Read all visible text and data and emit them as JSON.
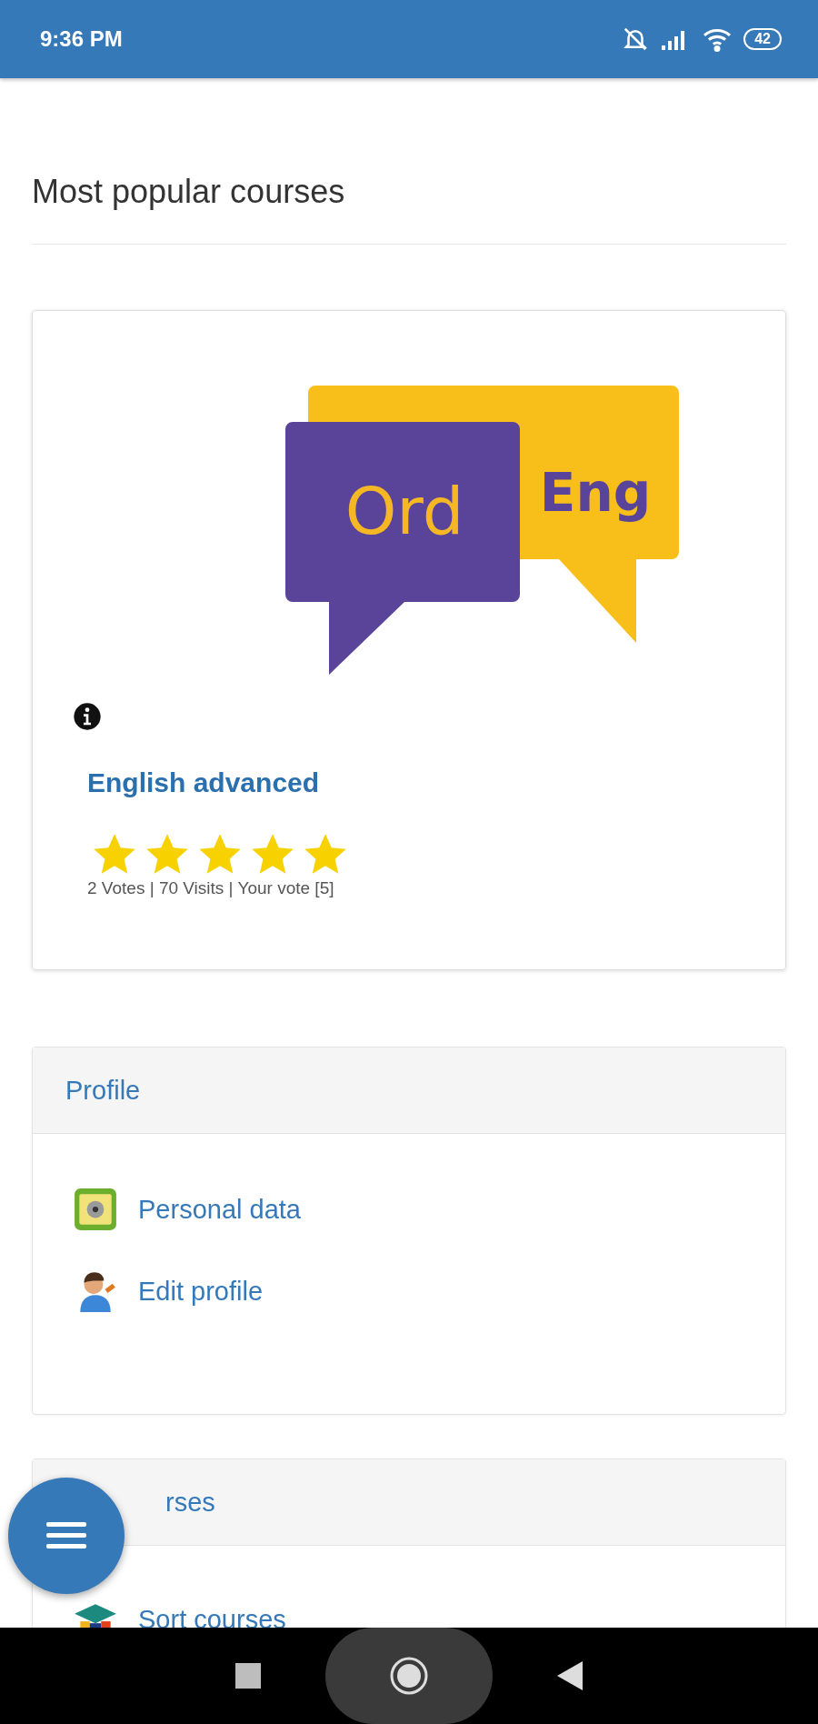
{
  "status_bar": {
    "time": "9:36 PM",
    "battery": "42"
  },
  "section_title": "Most popular courses",
  "course_card": {
    "logo": {
      "left_text": "Ord",
      "right_text": "Eng"
    },
    "title": "English advanced",
    "stars": 5,
    "stats": "2 Votes | 70 Visits | Your vote [5]"
  },
  "panels": [
    {
      "title": "Profile",
      "items": [
        {
          "label": "Personal data",
          "kind": "id-card"
        },
        {
          "label": "Edit profile",
          "kind": "person"
        }
      ]
    },
    {
      "title": "rses",
      "items": [
        {
          "label": "Sort courses",
          "kind": "graduation"
        }
      ]
    }
  ]
}
